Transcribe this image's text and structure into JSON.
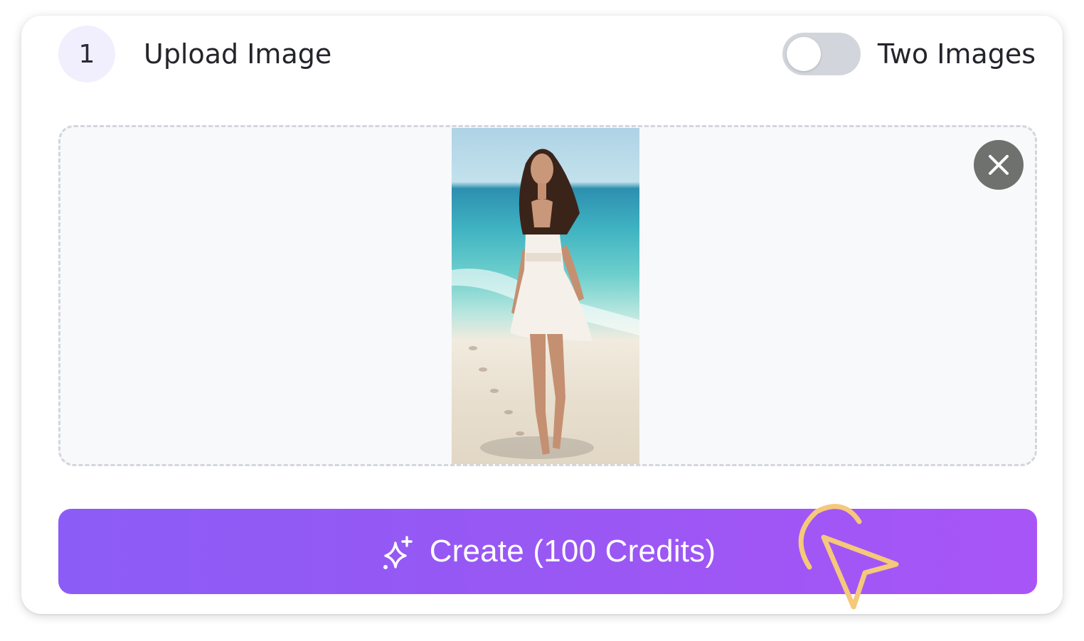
{
  "step": {
    "number": "1",
    "title": "Upload Image"
  },
  "toggle": {
    "label": "Two Images",
    "enabled": false
  },
  "upload": {
    "has_image": true,
    "preview_icon": "image-preview",
    "remove_icon": "close-icon"
  },
  "create_button": {
    "label": "Create (100 Credits)",
    "icon": "sparkle-icon"
  },
  "overlay": {
    "icon": "pointer-cursor-icon",
    "color": "#f5c87a"
  },
  "colors": {
    "accent_start": "#8c5cf6",
    "accent_end": "#a855f7",
    "badge_bg": "#f1effd",
    "toggle_off": "#d2d5db",
    "close_bg": "#6f716f"
  }
}
